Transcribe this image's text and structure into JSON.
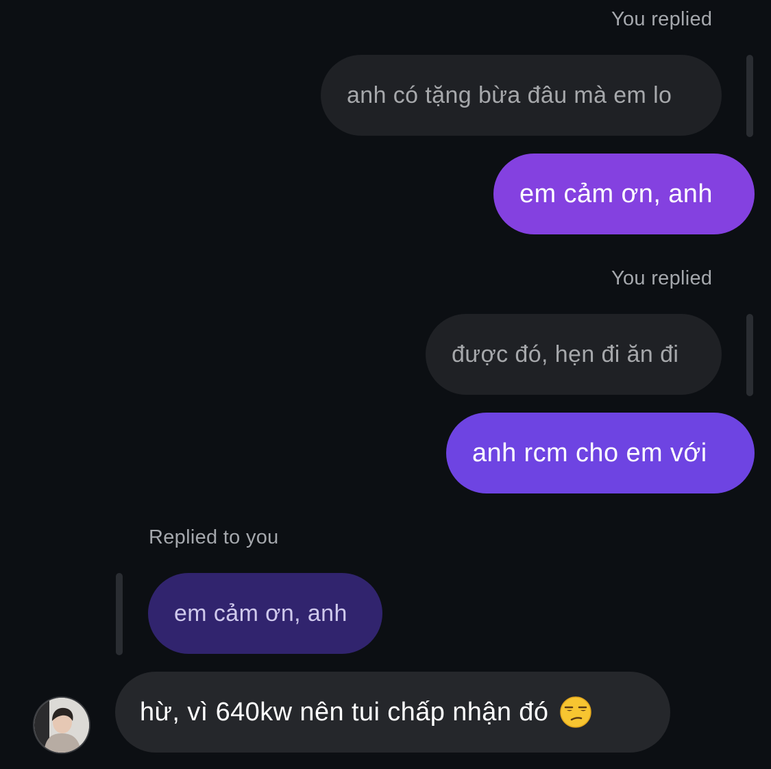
{
  "thread": {
    "reply_block_1": {
      "label": "You replied",
      "quoted_text": "anh có tặng bừa đâu mà em lo",
      "message": "em cảm ơn, anh",
      "message_color": "#8441e0"
    },
    "reply_block_2": {
      "label": "You replied",
      "quoted_text": "được đó, hẹn đi ăn đi",
      "message": "anh rcm cho em với",
      "message_color": "#6e44e2"
    },
    "reply_block_3": {
      "label": "Replied to you",
      "quoted_text": "em cảm ơn, anh",
      "message": "hừ, vì 640kw nên tui chấp nhận đó",
      "emoji": "unamused-face-icon"
    }
  },
  "colors": {
    "background": "#0c0f13",
    "bubble_dark": "#25272b",
    "quoted_dark": "#1f2125",
    "quoted_accent": "#31246e"
  }
}
